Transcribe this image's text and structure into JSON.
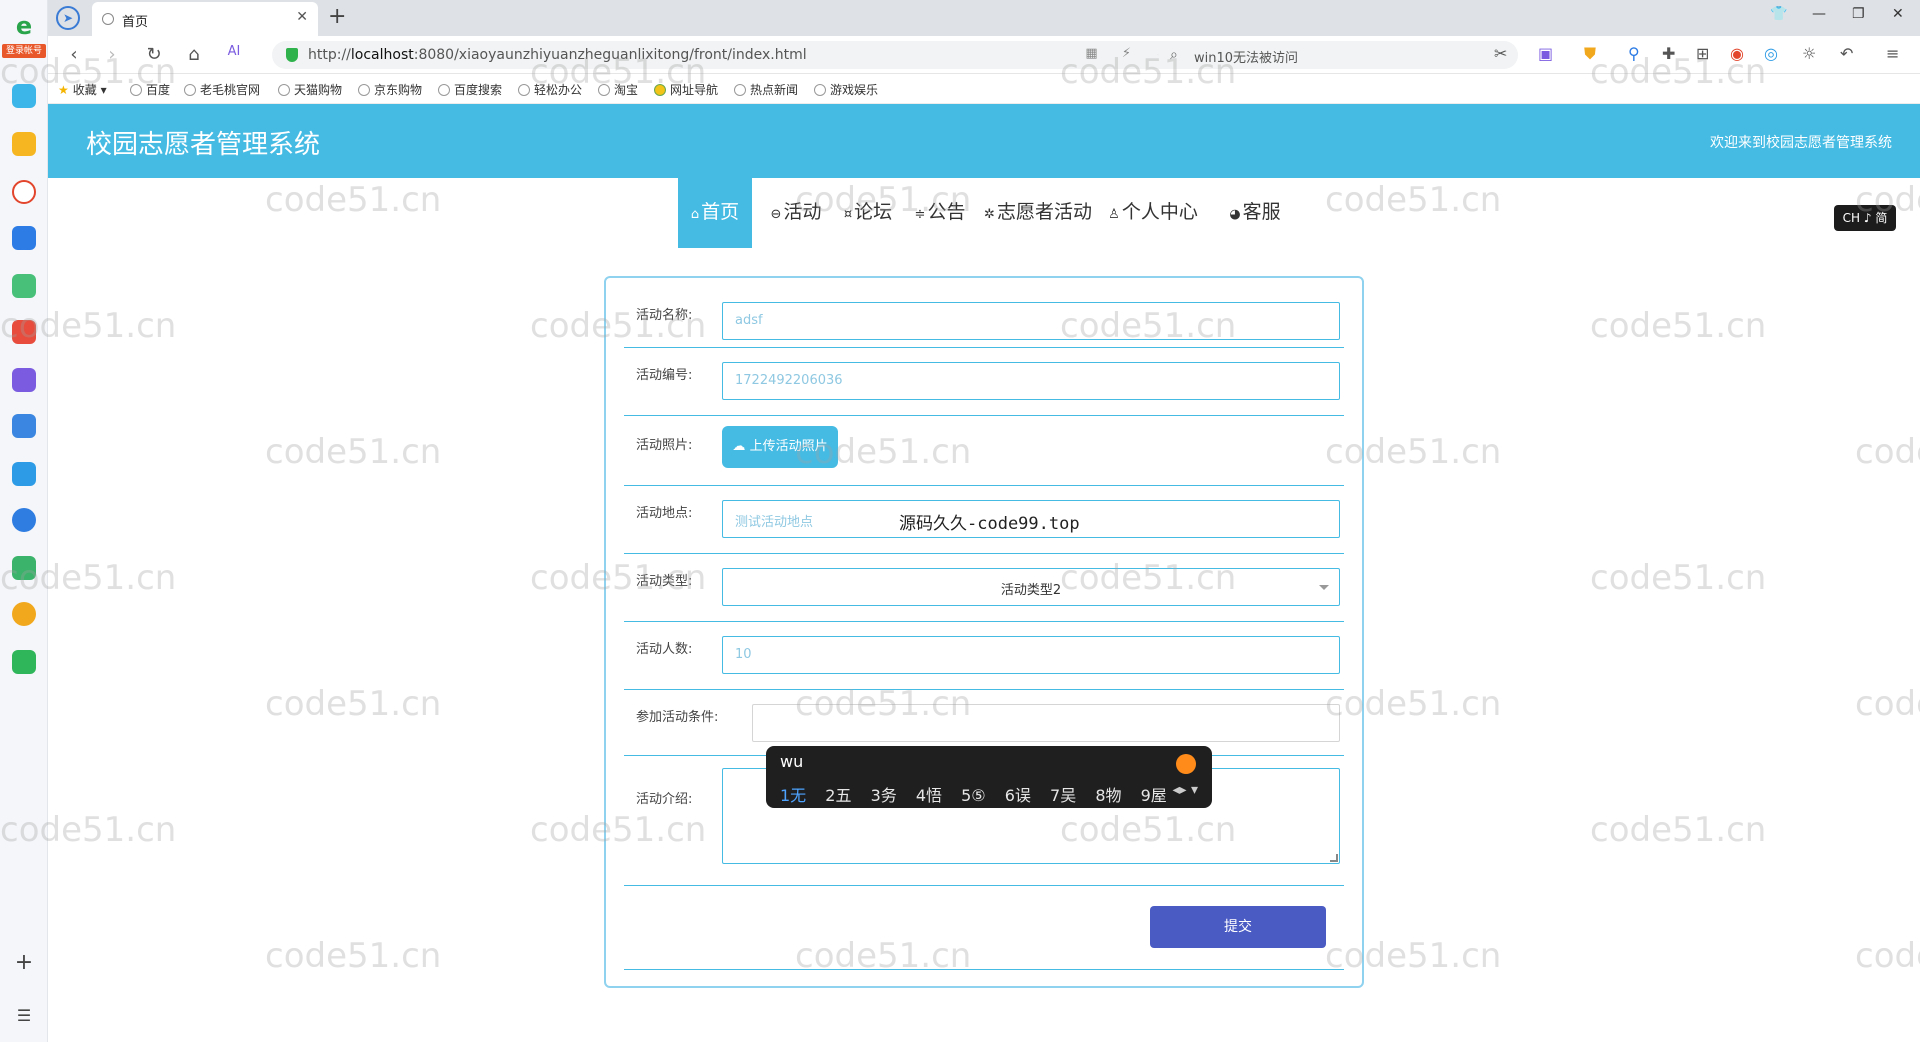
{
  "browser": {
    "tab_title": "首页",
    "url_prefix": "http://",
    "url_host": "localhost",
    "url_rest": ":8080/xiaoyaunzhiyuanzheguanlixitong/front/index.html",
    "search_text": "win10无法被访问",
    "sidebar_badge": "登录帐号",
    "bookmarks": [
      "收藏",
      "百度",
      "老毛桃官网",
      "天猫购物",
      "京东购物",
      "百度搜索",
      "轻松办公",
      "淘宝",
      "网址导航",
      "热点新闻",
      "游戏娱乐"
    ]
  },
  "site": {
    "title": "校园志愿者管理系统",
    "welcome": "欢迎来到校园志愿者管理系统",
    "nav": [
      {
        "label": "首页",
        "icon": "home-icon",
        "active": true
      },
      {
        "label": "活动",
        "icon": "activity-icon",
        "active": false
      },
      {
        "label": "论坛",
        "icon": "forum-icon",
        "active": false
      },
      {
        "label": "公告",
        "icon": "notice-icon",
        "active": false
      },
      {
        "label": "志愿者活动",
        "icon": "volunteer-icon",
        "active": false
      },
      {
        "label": "个人中心",
        "icon": "user-icon",
        "active": false
      },
      {
        "label": "客服",
        "icon": "service-icon",
        "active": false
      }
    ]
  },
  "lang_pill": "CH ♪ 简",
  "form": {
    "name_label": "活动名称:",
    "name_value": "adsf",
    "code_label": "活动编号:",
    "code_value": "1722492206036",
    "photo_label": "活动照片:",
    "upload_label": "上传活动照片",
    "place_label": "活动地点:",
    "place_value": "测试活动地点",
    "overlay_text": "源码久久-code99.top",
    "type_label": "活动类型:",
    "type_value": "活动类型2",
    "count_label": "活动人数:",
    "count_value": "10",
    "cond_label": "参加活动条件:",
    "cond_value": "",
    "intro_label": "活动介绍:",
    "submit_label": "提交"
  },
  "ime": {
    "composition": "wu",
    "candidates": [
      "1无",
      "2五",
      "3务",
      "4悟",
      "5⑤",
      "6误",
      "7吴",
      "8物",
      "9屋"
    ]
  },
  "watermark": "code51.cn"
}
